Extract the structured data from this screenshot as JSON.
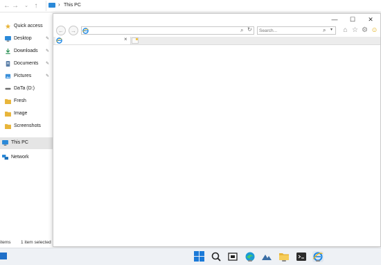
{
  "explorer": {
    "address_crumb": "This PC",
    "nav_items": [
      {
        "label": "Quick access",
        "icon": "star-icon",
        "pinned": false
      },
      {
        "label": "Desktop",
        "icon": "desktop-icon",
        "pinned": true
      },
      {
        "label": "Downloads",
        "icon": "download-icon",
        "pinned": true
      },
      {
        "label": "Documents",
        "icon": "documents-icon",
        "pinned": true
      },
      {
        "label": "Pictures",
        "icon": "pictures-icon",
        "pinned": true
      },
      {
        "label": "DaTa (D:)",
        "icon": "drive-icon",
        "pinned": false
      },
      {
        "label": "Fresh",
        "icon": "folder-icon",
        "pinned": false
      },
      {
        "label": "Image",
        "icon": "folder-icon",
        "pinned": false
      },
      {
        "label": "Screenshots",
        "icon": "folder-icon",
        "pinned": false
      },
      {
        "label": "This PC",
        "icon": "this-pc-icon",
        "pinned": false,
        "selected": true
      },
      {
        "label": "Network",
        "icon": "network-icon",
        "pinned": false
      }
    ],
    "status": {
      "items": "items",
      "selected": "1 item selected"
    }
  },
  "browser": {
    "search_placeholder": "Search...",
    "address_value": ""
  },
  "taskbar": {
    "items": [
      "start-icon",
      "search-icon",
      "task-view-icon",
      "edge-icon",
      "photos-icon",
      "file-explorer-icon",
      "terminal-icon",
      "internet-explorer-icon"
    ]
  },
  "colors": {
    "accent": "#1b7ad8",
    "folder": "#e8b53a",
    "selected_bg": "#e5e5e5"
  }
}
